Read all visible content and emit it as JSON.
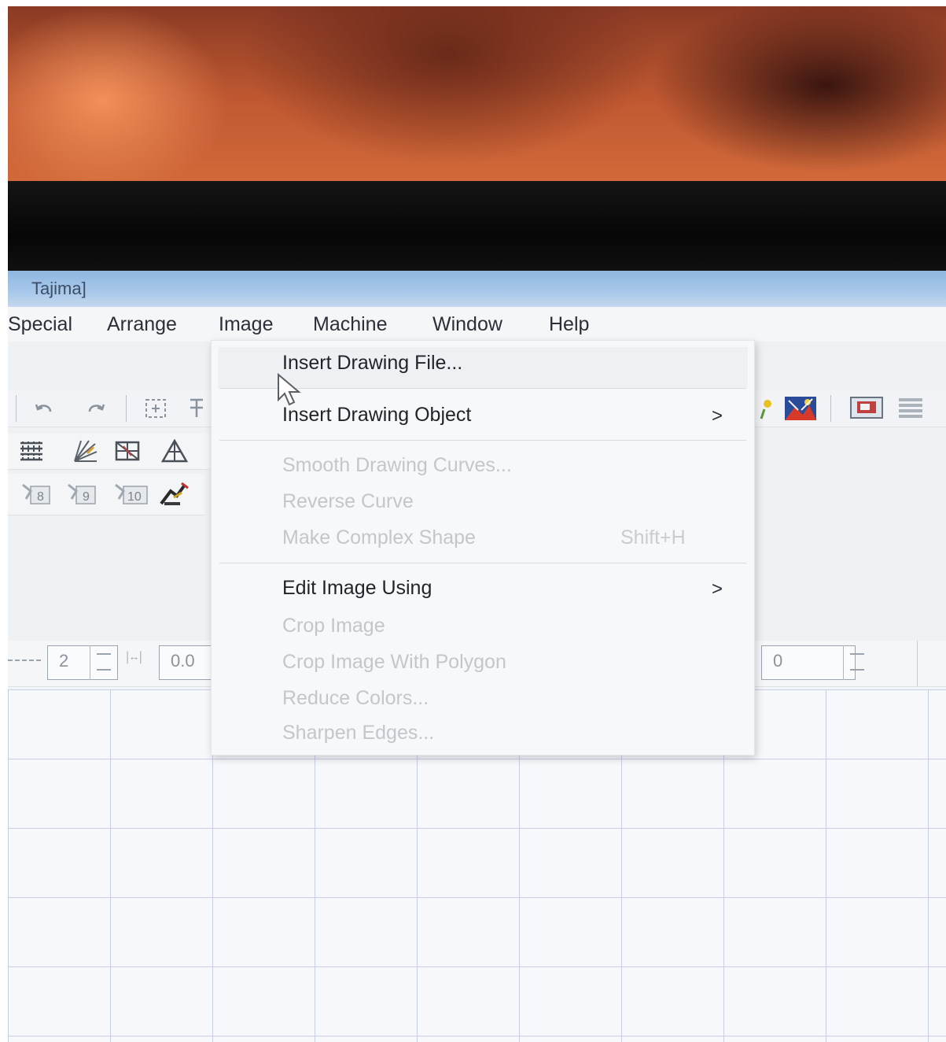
{
  "window": {
    "title": "Tajima]"
  },
  "menubar": {
    "items": [
      "Special",
      "Arrange",
      "Image",
      "Machine",
      "Window",
      "Help"
    ]
  },
  "image_menu": {
    "items": [
      {
        "label": "Insert Drawing File...",
        "enabled": true,
        "submenu": false,
        "shortcut": ""
      },
      {
        "label": "Insert Drawing Object",
        "enabled": true,
        "submenu": true,
        "shortcut": ""
      },
      {
        "label": "Smooth Drawing Curves...",
        "enabled": false,
        "submenu": false,
        "shortcut": ""
      },
      {
        "label": "Reverse Curve",
        "enabled": false,
        "submenu": false,
        "shortcut": ""
      },
      {
        "label": "Make Complex Shape",
        "enabled": false,
        "submenu": false,
        "shortcut": "Shift+H"
      },
      {
        "label": "Edit Image Using",
        "enabled": true,
        "submenu": true,
        "shortcut": ""
      },
      {
        "label": "Crop Image",
        "enabled": false,
        "submenu": false,
        "shortcut": ""
      },
      {
        "label": "Crop Image With Polygon",
        "enabled": false,
        "submenu": false,
        "shortcut": ""
      },
      {
        "label": "Reduce Colors...",
        "enabled": false,
        "submenu": false,
        "shortcut": ""
      },
      {
        "label": "Sharpen Edges...",
        "enabled": false,
        "submenu": false,
        "shortcut": ""
      }
    ],
    "submenu_arrow": ">"
  },
  "toolbar": {
    "stitch_buttons": [
      "8",
      "9",
      "10"
    ],
    "spin_values": {
      "count": "2",
      "spacing": "0.0",
      "angle": "0"
    }
  },
  "colors": {
    "accent_titlebar": "#a9c8ea",
    "menu_text": "#2a2f38",
    "disabled_text": "#c2c7cc",
    "grid_line": "#c7d0e2"
  },
  "icons": [
    "undo-icon",
    "redo-icon",
    "select-icon",
    "node-edit-icon",
    "fill-stitch-icon",
    "fan-stitch-icon",
    "grid-fill-icon",
    "triangle-icon",
    "stitch-8-icon",
    "stitch-9-icon",
    "stitch-10-icon",
    "tool-icon",
    "flower-icon",
    "image-icon",
    "monitor-icon",
    "dots-grid-icon",
    "mouse-pointer-icon"
  ]
}
